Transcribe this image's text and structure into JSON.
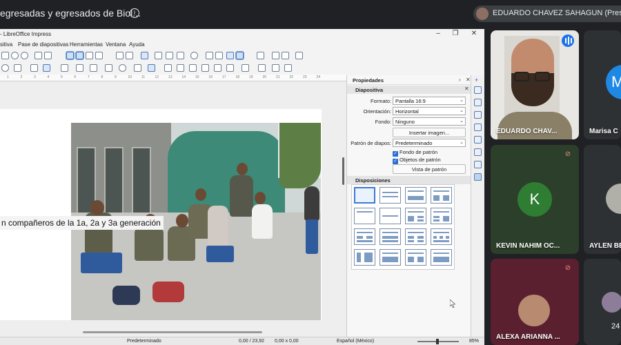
{
  "meet": {
    "title": "egresadas y egresados de Biol...",
    "presenter": "EDUARDO CHAVEZ SAHAGUN (Presenta"
  },
  "impress": {
    "window_title": "- LibreOffice Impress",
    "menu": [
      "sitiva",
      "Pase de diapositivas",
      "Herramientas",
      "Ventana",
      "Ayuda"
    ],
    "slide_caption": "n compañeros de la 1a, 2a y 3a generación",
    "sidebar": {
      "title": "Propiedades",
      "section_slide": "Diapositiva",
      "format_label": "Formato:",
      "format_value": "Pantalla 16:9",
      "orientation_label": "Orientación:",
      "orientation_value": "Horizontal",
      "background_label": "Fondo:",
      "background_value": "Ninguno",
      "insert_image": "Insertar imagen...",
      "master_label": "Patrón de diapos:",
      "master_value": "Predeterminado",
      "master_background": "Fondo de patrón",
      "master_objects": "Objetos de patrón",
      "master_view": "Vista de patrón",
      "section_layouts": "Disposiciones"
    },
    "status": {
      "master": "Predeterminado",
      "position": "0,00 / 23,92",
      "size": "0,00 x 0,00",
      "language": "Español (México)",
      "zoom": "85%"
    },
    "ruler_numbers": [
      "1",
      "2",
      "3",
      "4",
      "5",
      "6",
      "7",
      "8",
      "9",
      "10",
      "11",
      "12",
      "13",
      "14",
      "15",
      "16",
      "17",
      "18",
      "19",
      "20",
      "21",
      "22",
      "23",
      "24"
    ]
  },
  "participants": [
    {
      "name": "EDUARDO CHAV..."
    },
    {
      "name": "Marisa C"
    },
    {
      "name": "KEVIN NAHIM OC...",
      "initial": "K"
    },
    {
      "name": "AYLEN BE"
    },
    {
      "name": "ALEXA ARIANNA ..."
    },
    {
      "name": "24"
    }
  ]
}
